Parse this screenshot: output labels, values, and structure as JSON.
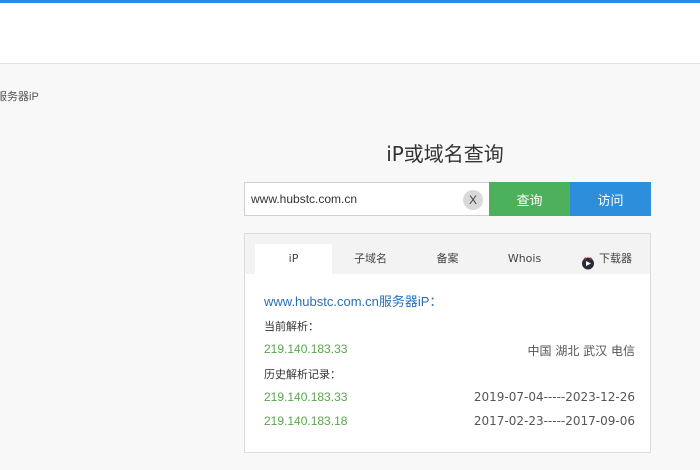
{
  "colors": {
    "accent": "#2b8ae6",
    "query_button": "#4cb05c",
    "visit_button": "#2d8fdb",
    "ip_green": "#5aa64c",
    "link_blue": "#2a6fb3"
  },
  "breadcrumb": {
    "text": "服务器iP"
  },
  "page": {
    "title": "iP或域名查询"
  },
  "search": {
    "value": "www.hubstc.com.cn",
    "clear_label": "X",
    "query_label": "查询",
    "visit_label": "访问"
  },
  "tabs": [
    {
      "label": "iP",
      "active": true
    },
    {
      "label": "子域名",
      "active": false
    },
    {
      "label": "备案",
      "active": false
    },
    {
      "label": "Whois",
      "active": false
    },
    {
      "label": "下载器",
      "active": false,
      "icon": "downloader-icon"
    }
  ],
  "result": {
    "domain": "www.hubstc.com.cn",
    "heading_suffix": "服务器iP：",
    "current_label": "当前解析：",
    "current": {
      "ip": "219.140.183.33",
      "location": "中国 湖北 武汉 电信"
    },
    "history_label": "历史解析记录：",
    "history": [
      {
        "ip": "219.140.183.33",
        "range": "2019-07-04-----2023-12-26"
      },
      {
        "ip": "219.140.183.18",
        "range": "2017-02-23-----2017-09-06"
      }
    ]
  }
}
